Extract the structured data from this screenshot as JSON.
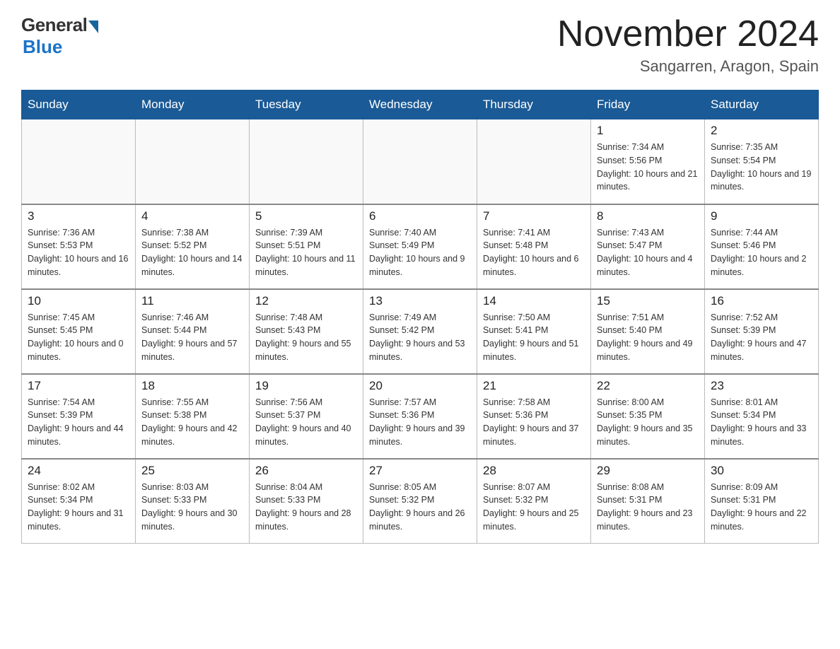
{
  "header": {
    "logo_general": "General",
    "logo_blue": "Blue",
    "month_title": "November 2024",
    "location": "Sangarren, Aragon, Spain"
  },
  "weekdays": [
    "Sunday",
    "Monday",
    "Tuesday",
    "Wednesday",
    "Thursday",
    "Friday",
    "Saturday"
  ],
  "weeks": [
    [
      {
        "day": "",
        "sunrise": "",
        "sunset": "",
        "daylight": ""
      },
      {
        "day": "",
        "sunrise": "",
        "sunset": "",
        "daylight": ""
      },
      {
        "day": "",
        "sunrise": "",
        "sunset": "",
        "daylight": ""
      },
      {
        "day": "",
        "sunrise": "",
        "sunset": "",
        "daylight": ""
      },
      {
        "day": "",
        "sunrise": "",
        "sunset": "",
        "daylight": ""
      },
      {
        "day": "1",
        "sunrise": "Sunrise: 7:34 AM",
        "sunset": "Sunset: 5:56 PM",
        "daylight": "Daylight: 10 hours and 21 minutes."
      },
      {
        "day": "2",
        "sunrise": "Sunrise: 7:35 AM",
        "sunset": "Sunset: 5:54 PM",
        "daylight": "Daylight: 10 hours and 19 minutes."
      }
    ],
    [
      {
        "day": "3",
        "sunrise": "Sunrise: 7:36 AM",
        "sunset": "Sunset: 5:53 PM",
        "daylight": "Daylight: 10 hours and 16 minutes."
      },
      {
        "day": "4",
        "sunrise": "Sunrise: 7:38 AM",
        "sunset": "Sunset: 5:52 PM",
        "daylight": "Daylight: 10 hours and 14 minutes."
      },
      {
        "day": "5",
        "sunrise": "Sunrise: 7:39 AM",
        "sunset": "Sunset: 5:51 PM",
        "daylight": "Daylight: 10 hours and 11 minutes."
      },
      {
        "day": "6",
        "sunrise": "Sunrise: 7:40 AM",
        "sunset": "Sunset: 5:49 PM",
        "daylight": "Daylight: 10 hours and 9 minutes."
      },
      {
        "day": "7",
        "sunrise": "Sunrise: 7:41 AM",
        "sunset": "Sunset: 5:48 PM",
        "daylight": "Daylight: 10 hours and 6 minutes."
      },
      {
        "day": "8",
        "sunrise": "Sunrise: 7:43 AM",
        "sunset": "Sunset: 5:47 PM",
        "daylight": "Daylight: 10 hours and 4 minutes."
      },
      {
        "day": "9",
        "sunrise": "Sunrise: 7:44 AM",
        "sunset": "Sunset: 5:46 PM",
        "daylight": "Daylight: 10 hours and 2 minutes."
      }
    ],
    [
      {
        "day": "10",
        "sunrise": "Sunrise: 7:45 AM",
        "sunset": "Sunset: 5:45 PM",
        "daylight": "Daylight: 10 hours and 0 minutes."
      },
      {
        "day": "11",
        "sunrise": "Sunrise: 7:46 AM",
        "sunset": "Sunset: 5:44 PM",
        "daylight": "Daylight: 9 hours and 57 minutes."
      },
      {
        "day": "12",
        "sunrise": "Sunrise: 7:48 AM",
        "sunset": "Sunset: 5:43 PM",
        "daylight": "Daylight: 9 hours and 55 minutes."
      },
      {
        "day": "13",
        "sunrise": "Sunrise: 7:49 AM",
        "sunset": "Sunset: 5:42 PM",
        "daylight": "Daylight: 9 hours and 53 minutes."
      },
      {
        "day": "14",
        "sunrise": "Sunrise: 7:50 AM",
        "sunset": "Sunset: 5:41 PM",
        "daylight": "Daylight: 9 hours and 51 minutes."
      },
      {
        "day": "15",
        "sunrise": "Sunrise: 7:51 AM",
        "sunset": "Sunset: 5:40 PM",
        "daylight": "Daylight: 9 hours and 49 minutes."
      },
      {
        "day": "16",
        "sunrise": "Sunrise: 7:52 AM",
        "sunset": "Sunset: 5:39 PM",
        "daylight": "Daylight: 9 hours and 47 minutes."
      }
    ],
    [
      {
        "day": "17",
        "sunrise": "Sunrise: 7:54 AM",
        "sunset": "Sunset: 5:39 PM",
        "daylight": "Daylight: 9 hours and 44 minutes."
      },
      {
        "day": "18",
        "sunrise": "Sunrise: 7:55 AM",
        "sunset": "Sunset: 5:38 PM",
        "daylight": "Daylight: 9 hours and 42 minutes."
      },
      {
        "day": "19",
        "sunrise": "Sunrise: 7:56 AM",
        "sunset": "Sunset: 5:37 PM",
        "daylight": "Daylight: 9 hours and 40 minutes."
      },
      {
        "day": "20",
        "sunrise": "Sunrise: 7:57 AM",
        "sunset": "Sunset: 5:36 PM",
        "daylight": "Daylight: 9 hours and 39 minutes."
      },
      {
        "day": "21",
        "sunrise": "Sunrise: 7:58 AM",
        "sunset": "Sunset: 5:36 PM",
        "daylight": "Daylight: 9 hours and 37 minutes."
      },
      {
        "day": "22",
        "sunrise": "Sunrise: 8:00 AM",
        "sunset": "Sunset: 5:35 PM",
        "daylight": "Daylight: 9 hours and 35 minutes."
      },
      {
        "day": "23",
        "sunrise": "Sunrise: 8:01 AM",
        "sunset": "Sunset: 5:34 PM",
        "daylight": "Daylight: 9 hours and 33 minutes."
      }
    ],
    [
      {
        "day": "24",
        "sunrise": "Sunrise: 8:02 AM",
        "sunset": "Sunset: 5:34 PM",
        "daylight": "Daylight: 9 hours and 31 minutes."
      },
      {
        "day": "25",
        "sunrise": "Sunrise: 8:03 AM",
        "sunset": "Sunset: 5:33 PM",
        "daylight": "Daylight: 9 hours and 30 minutes."
      },
      {
        "day": "26",
        "sunrise": "Sunrise: 8:04 AM",
        "sunset": "Sunset: 5:33 PM",
        "daylight": "Daylight: 9 hours and 28 minutes."
      },
      {
        "day": "27",
        "sunrise": "Sunrise: 8:05 AM",
        "sunset": "Sunset: 5:32 PM",
        "daylight": "Daylight: 9 hours and 26 minutes."
      },
      {
        "day": "28",
        "sunrise": "Sunrise: 8:07 AM",
        "sunset": "Sunset: 5:32 PM",
        "daylight": "Daylight: 9 hours and 25 minutes."
      },
      {
        "day": "29",
        "sunrise": "Sunrise: 8:08 AM",
        "sunset": "Sunset: 5:31 PM",
        "daylight": "Daylight: 9 hours and 23 minutes."
      },
      {
        "day": "30",
        "sunrise": "Sunrise: 8:09 AM",
        "sunset": "Sunset: 5:31 PM",
        "daylight": "Daylight: 9 hours and 22 minutes."
      }
    ]
  ]
}
